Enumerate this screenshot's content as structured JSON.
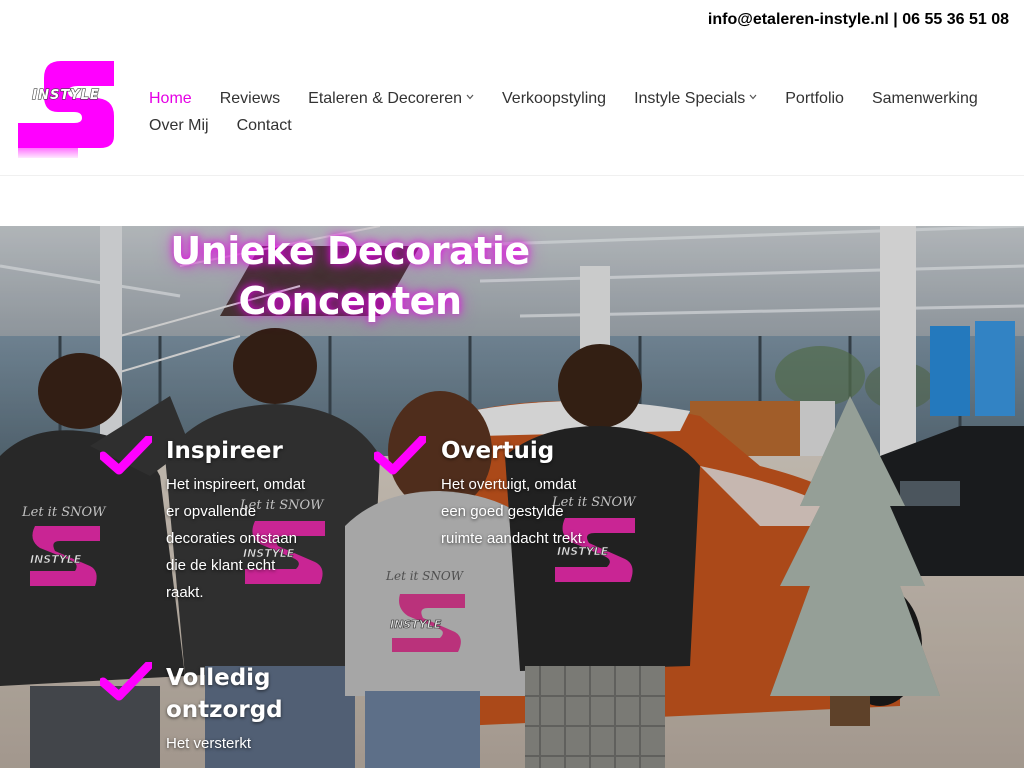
{
  "topbar": {
    "contact": "info@etaleren-instyle.nl | 06 55 36 51 08"
  },
  "logo": {
    "text": "INSTYLE"
  },
  "nav": {
    "row1": [
      {
        "label": "Home",
        "active": true,
        "has_dropdown": false
      },
      {
        "label": "Reviews",
        "active": false,
        "has_dropdown": false
      },
      {
        "label": "Etaleren & Decoreren",
        "active": false,
        "has_dropdown": true
      },
      {
        "label": "Verkoopstyling",
        "active": false,
        "has_dropdown": false
      },
      {
        "label": "Instyle Specials",
        "active": false,
        "has_dropdown": true
      },
      {
        "label": "Portfolio",
        "active": false,
        "has_dropdown": false
      },
      {
        "label": "Samenwerking",
        "active": false,
        "has_dropdown": false
      }
    ],
    "row2": [
      {
        "label": "Over Mij",
        "active": false,
        "has_dropdown": false
      },
      {
        "label": "Contact",
        "active": false,
        "has_dropdown": false
      }
    ],
    "chevron": "⌵"
  },
  "hero": {
    "title_line1": "Unieke Decoratie",
    "title_line2": "Concepten",
    "features": [
      {
        "title": "Inspireer",
        "lines": [
          "Het inspireert, omdat",
          "er opvallende",
          "decoraties ontstaan",
          "die de klant echt",
          "raakt."
        ]
      },
      {
        "title": "Overtuig",
        "lines": [
          "Het overtuigt, omdat",
          "een goed gestylde",
          "ruimte aandacht trekt."
        ]
      },
      {
        "title_lines": [
          "Volledig",
          "ontzorgd"
        ],
        "lines": [
          "Het versterkt"
        ]
      }
    ],
    "hoodie_print_1": "Let it SNOW",
    "hoodie_print_2": "Let it SNOW",
    "hoodie_print_3": "Let it SNOW",
    "hoodie_print_4": "Let it SNOW",
    "hoodie_logo": "INSTYLE"
  },
  "colors": {
    "accent": "#e500e5",
    "nav_text": "#333333",
    "check": "#ff00ff"
  }
}
